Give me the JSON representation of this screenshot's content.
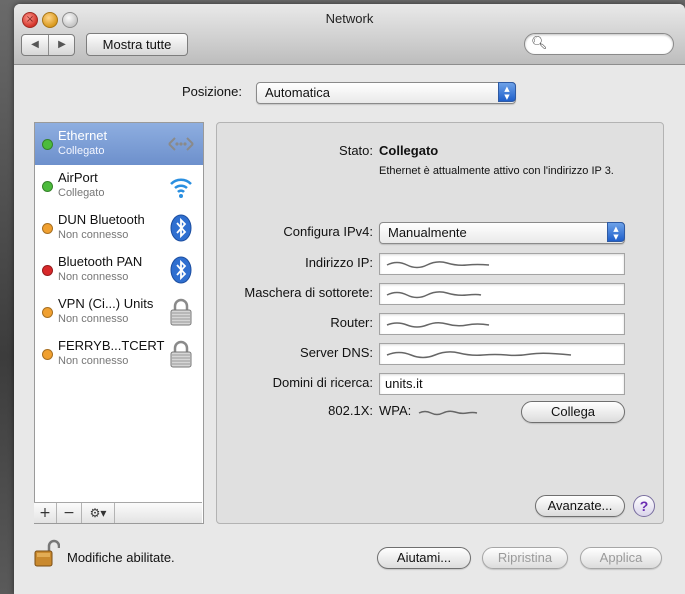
{
  "window": {
    "title": "Network"
  },
  "toolbar": {
    "back_icon": "◀",
    "forward_icon": "▶",
    "show_all_label": "Mostra tutte",
    "search_placeholder": ""
  },
  "location": {
    "label": "Posizione:",
    "value": "Automatica"
  },
  "services": [
    {
      "name": "Ethernet",
      "status": "Collegato",
      "status_color": "#4cbb3c",
      "icon": "ethernet-icon",
      "selected": true
    },
    {
      "name": "AirPort",
      "status": "Collegato",
      "status_color": "#4cbb3c",
      "icon": "wifi-icon",
      "selected": false
    },
    {
      "name": "DUN Bluetooth",
      "status": "Non connesso",
      "status_color": "#f0a030",
      "icon": "bluetooth-icon",
      "selected": false
    },
    {
      "name": "Bluetooth PAN",
      "status": "Non connesso",
      "status_color": "#d8282a",
      "icon": "bluetooth-icon",
      "selected": false
    },
    {
      "name": "VPN (Ci...) Units",
      "status": "Non connesso",
      "status_color": "#f0a030",
      "icon": "vpn-lock-icon",
      "selected": false
    },
    {
      "name": "FERRYB...TCERT",
      "status": "Non connesso",
      "status_color": "#f0a030",
      "icon": "vpn-lock-icon",
      "selected": false
    }
  ],
  "list_controls": {
    "add": "+",
    "remove": "−",
    "gear": "⚙▾"
  },
  "detail": {
    "status_label": "Stato:",
    "status_value": "Collegato",
    "status_desc": "Ethernet è attualmente attivo con l'indirizzo IP 3.",
    "configure_label": "Configura IPv4:",
    "configure_value": "Manualmente",
    "ip_label": "Indirizzo IP:",
    "ip_value": "",
    "mask_label": "Maschera di sottorete:",
    "mask_value": "",
    "router_label": "Router:",
    "router_value": "",
    "dns_label": "Server DNS:",
    "dns_value": "",
    "search_label": "Domini di ricerca:",
    "search_value": "units.it",
    "dot1x_label": "802.1X:",
    "dot1x_value": "WPA:",
    "connect_label": "Collega",
    "advanced_label": "Avanzate...",
    "help_symbol": "?"
  },
  "footer": {
    "lock_label": "Modifiche abilitate.",
    "help_label": "Aiutami...",
    "revert_label": "Ripristina",
    "apply_label": "Applica"
  }
}
